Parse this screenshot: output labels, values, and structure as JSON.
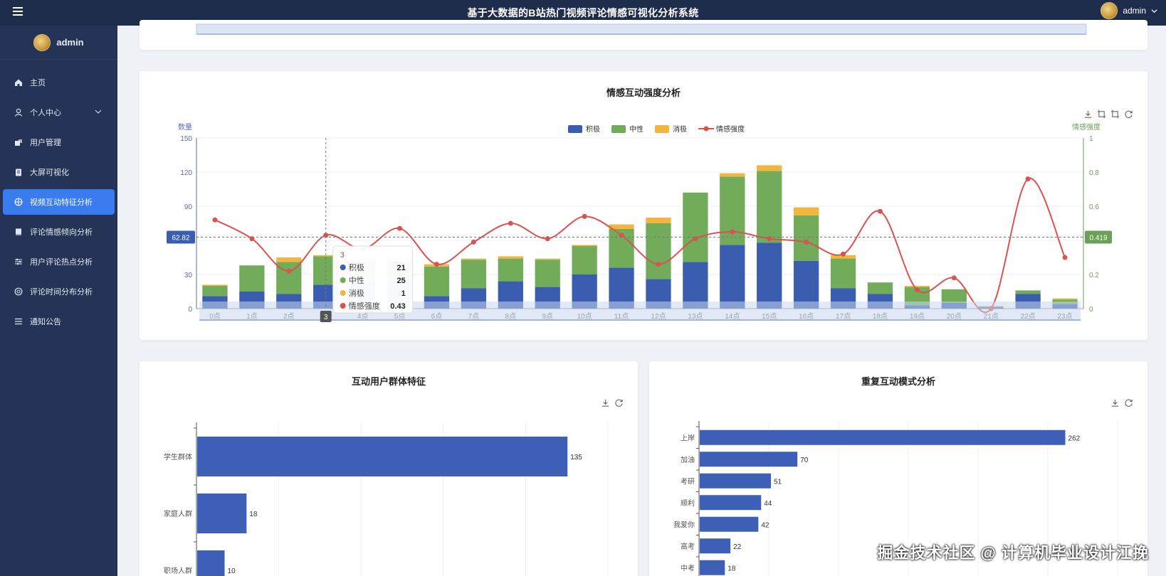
{
  "header": {
    "title": "基于大数据的B站热门视频评论情感可视化分析系统",
    "user": "admin"
  },
  "sidebar": {
    "user": "admin",
    "items": [
      {
        "label": "主页",
        "icon": "home-icon"
      },
      {
        "label": "个人中心",
        "icon": "user-icon"
      },
      {
        "label": "用户管理",
        "icon": "users-icon"
      },
      {
        "label": "大屏可视化",
        "icon": "clipboard-icon"
      },
      {
        "label": "视频互动特征分析",
        "icon": "target-icon"
      },
      {
        "label": "评论情感倾向分析",
        "icon": "book-icon"
      },
      {
        "label": "用户评论热点分析",
        "icon": "sliders-icon"
      },
      {
        "label": "评论时间分布分析",
        "icon": "disc-icon"
      },
      {
        "label": "通知公告",
        "icon": "list-icon"
      }
    ],
    "active_index": 4
  },
  "colors": {
    "positive": "#3b5db0",
    "neutral": "#72ab5a",
    "negative": "#f0b63e",
    "intensity": "#d9534f",
    "bar_blue": "#3d5fb5"
  },
  "chart_data": [
    {
      "type": "bar",
      "title": "情感互动强度分析",
      "ylabel": "数量",
      "y2label": "情感强度",
      "ylim": [
        0,
        150
      ],
      "y2lim": [
        0,
        1
      ],
      "yticks": [
        0,
        30,
        60,
        90,
        120,
        150
      ],
      "y2ticks": [
        0,
        0.2,
        0.4,
        0.6,
        0.8,
        1
      ],
      "legend_position": "top",
      "stacked": true,
      "categories": [
        "0点",
        "1点",
        "2点",
        "3点",
        "4点",
        "5点",
        "6点",
        "7点",
        "8点",
        "9点",
        "10点",
        "11点",
        "12点",
        "13点",
        "14点",
        "15点",
        "16点",
        "17点",
        "18点",
        "19点",
        "20点",
        "21点",
        "22点",
        "23点"
      ],
      "series": [
        {
          "name": "积极",
          "kind": "bar",
          "values": [
            11,
            15,
            13,
            21,
            24,
            25,
            11,
            18,
            24,
            19,
            30,
            36,
            26,
            41,
            56,
            58,
            42,
            18,
            13,
            3,
            5,
            1,
            13,
            4
          ]
        },
        {
          "name": "中性",
          "kind": "bar",
          "values": [
            9,
            23,
            28,
            25,
            18,
            17,
            26,
            25,
            20,
            24,
            25,
            34,
            49,
            61,
            60,
            63,
            40,
            26,
            10,
            16,
            12,
            1,
            3,
            4
          ]
        },
        {
          "name": "消极",
          "kind": "bar",
          "values": [
            1,
            0,
            4,
            1,
            2,
            2,
            2,
            1,
            2,
            1,
            1,
            4,
            5,
            0,
            3,
            5,
            7,
            3,
            0,
            1,
            0,
            0,
            0,
            1
          ]
        },
        {
          "name": "情感强度",
          "kind": "line",
          "axis": "right",
          "values": [
            0.52,
            0.41,
            0.22,
            0.43,
            0.35,
            0.47,
            0.26,
            0.39,
            0.5,
            0.41,
            0.54,
            0.43,
            0.26,
            0.41,
            0.45,
            0.41,
            0.39,
            0.32,
            0.57,
            0.11,
            0.18,
            0.0,
            0.76,
            0.3
          ]
        }
      ],
      "axis_pointer": {
        "x_label": "3",
        "y_label": "62.82",
        "y2_label": "0.419"
      },
      "tooltip": {
        "title": "3",
        "rows": [
          {
            "name": "积极",
            "value": "21"
          },
          {
            "name": "中性",
            "value": "25"
          },
          {
            "name": "消极",
            "value": "1"
          },
          {
            "name": "情感强度",
            "value": "0.43"
          }
        ]
      }
    },
    {
      "type": "bar",
      "orientation": "horizontal",
      "title": "互动用户群体特征",
      "categories": [
        "学生群体",
        "家庭人群",
        "职场人群"
      ],
      "values": [
        135,
        18,
        10
      ],
      "xlim": [
        0,
        150
      ]
    },
    {
      "type": "bar",
      "orientation": "horizontal",
      "title": "重复互动模式分析",
      "categories": [
        "上岸",
        "加油",
        "考研",
        "顺利",
        "我爱你",
        "高考",
        "中考"
      ],
      "values": [
        262,
        70,
        51,
        44,
        42,
        22,
        18
      ],
      "xlim": [
        0,
        300
      ]
    }
  ],
  "watermark": "掘金技术社区 @ 计算机毕业设计江挽"
}
